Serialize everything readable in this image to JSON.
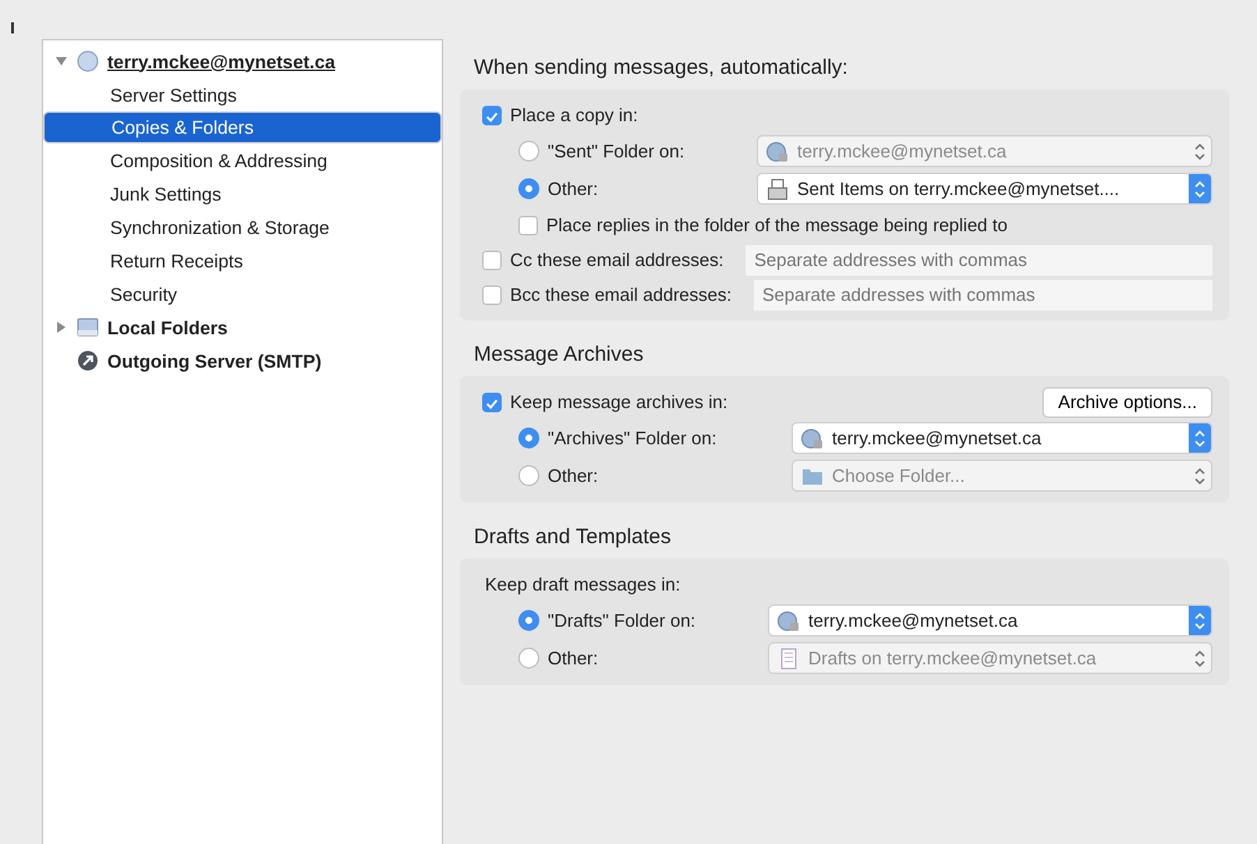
{
  "sidebar": {
    "items": [
      {
        "label": "terry.mckee@mynetset.ca",
        "kind": "account",
        "expanded": true,
        "selected": false,
        "children": [
          {
            "label": "Server Settings",
            "selected": false
          },
          {
            "label": "Copies & Folders",
            "selected": true
          },
          {
            "label": "Composition & Addressing",
            "selected": false
          },
          {
            "label": "Junk Settings",
            "selected": false
          },
          {
            "label": "Synchronization & Storage",
            "selected": false
          },
          {
            "label": "Return Receipts",
            "selected": false
          },
          {
            "label": "Security",
            "selected": false
          }
        ]
      },
      {
        "label": "Local Folders",
        "kind": "local",
        "expanded": false,
        "selected": false
      },
      {
        "label": "Outgoing Server (SMTP)",
        "kind": "smtp",
        "selected": false
      }
    ]
  },
  "sections": [
    {
      "title": "When sending messages, automatically:",
      "rows": [
        {
          "kind": "checkbox",
          "label": "Place a copy in:",
          "checked": true,
          "children": [
            {
              "kind": "radio",
              "label": "\"Sent\" Folder on:",
              "selected": false,
              "select": {
                "value": "terry.mckee@mynetset.ca",
                "kind": "account",
                "disabled": true
              }
            },
            {
              "kind": "radio",
              "label": "Other:",
              "selected": true,
              "select": {
                "value": "Sent Items on terry.mckee@mynetset....",
                "kind": "tray",
                "disabled": false
              }
            },
            {
              "kind": "checkbox",
              "label": "Place replies in the folder of the message being replied to",
              "checked": false
            }
          ]
        },
        {
          "kind": "checkbox_field",
          "label": "Cc these email addresses:",
          "checked": false,
          "placeholder": "Separate addresses with commas"
        },
        {
          "kind": "checkbox_field",
          "label": "Bcc these email addresses:",
          "checked": false,
          "placeholder": "Separate addresses with commas"
        }
      ]
    },
    {
      "title": "Message Archives",
      "rows": [
        {
          "kind": "checkbox",
          "label": "Keep message archives in:",
          "checked": true,
          "button": "Archive options...",
          "children": [
            {
              "kind": "radio",
              "label": "\"Archives\" Folder on:",
              "selected": true,
              "select": {
                "value": "terry.mckee@mynetset.ca",
                "kind": "account",
                "disabled": false
              }
            },
            {
              "kind": "radio",
              "label": "Other:",
              "selected": false,
              "select": {
                "value": "Choose Folder...",
                "kind": "folder",
                "disabled": true
              }
            }
          ]
        }
      ]
    },
    {
      "title": "Drafts and Templates",
      "rows": [
        {
          "kind": "label",
          "label": "Keep draft messages in:",
          "children": [
            {
              "kind": "radio",
              "label": "\"Drafts\" Folder on:",
              "selected": true,
              "select": {
                "value": "terry.mckee@mynetset.ca",
                "kind": "account",
                "disabled": false
              }
            },
            {
              "kind": "radio",
              "label": "Other:",
              "selected": false,
              "select": {
                "value": "Drafts on terry.mckee@mynetset.ca",
                "kind": "notes",
                "disabled": true
              }
            }
          ]
        }
      ]
    }
  ]
}
